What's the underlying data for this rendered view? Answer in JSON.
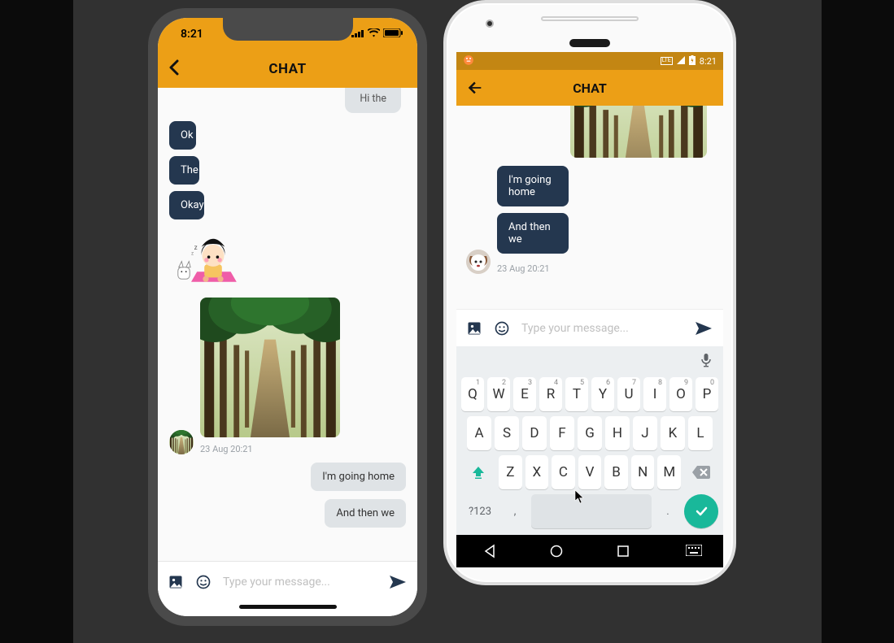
{
  "colors": {
    "accent": "#ec9f16",
    "bubble": "#24374f",
    "enter": "#19b89a"
  },
  "ios": {
    "status": {
      "time": "8:21"
    },
    "nav": {
      "title": "CHAT"
    },
    "clipped_incoming": "Hi the",
    "outgoing": [
      "Ok",
      "The",
      "Okay"
    ],
    "timestamp": "23 Aug 20:21",
    "incoming": [
      "I'm going home",
      "And then we"
    ],
    "composer": {
      "placeholder": "Type your message..."
    }
  },
  "android": {
    "status": {
      "time": "8:21",
      "lte": "LTE"
    },
    "nav": {
      "title": "CHAT"
    },
    "outgoing": [
      "I'm going home",
      "And then we"
    ],
    "timestamp": "23 Aug 20:21",
    "composer": {
      "placeholder": "Type your message..."
    }
  },
  "keyboard": {
    "row1": [
      {
        "k": "Q",
        "n": "1"
      },
      {
        "k": "W",
        "n": "2"
      },
      {
        "k": "E",
        "n": "3"
      },
      {
        "k": "R",
        "n": "4"
      },
      {
        "k": "T",
        "n": "5"
      },
      {
        "k": "Y",
        "n": "6"
      },
      {
        "k": "U",
        "n": "7"
      },
      {
        "k": "I",
        "n": "8"
      },
      {
        "k": "O",
        "n": "9"
      },
      {
        "k": "P",
        "n": "0"
      }
    ],
    "row2": [
      "A",
      "S",
      "D",
      "F",
      "G",
      "H",
      "J",
      "K",
      "L"
    ],
    "row3": [
      "Z",
      "X",
      "C",
      "V",
      "B",
      "N",
      "M"
    ],
    "sym": "?123",
    "comma": ",",
    "period": "."
  }
}
